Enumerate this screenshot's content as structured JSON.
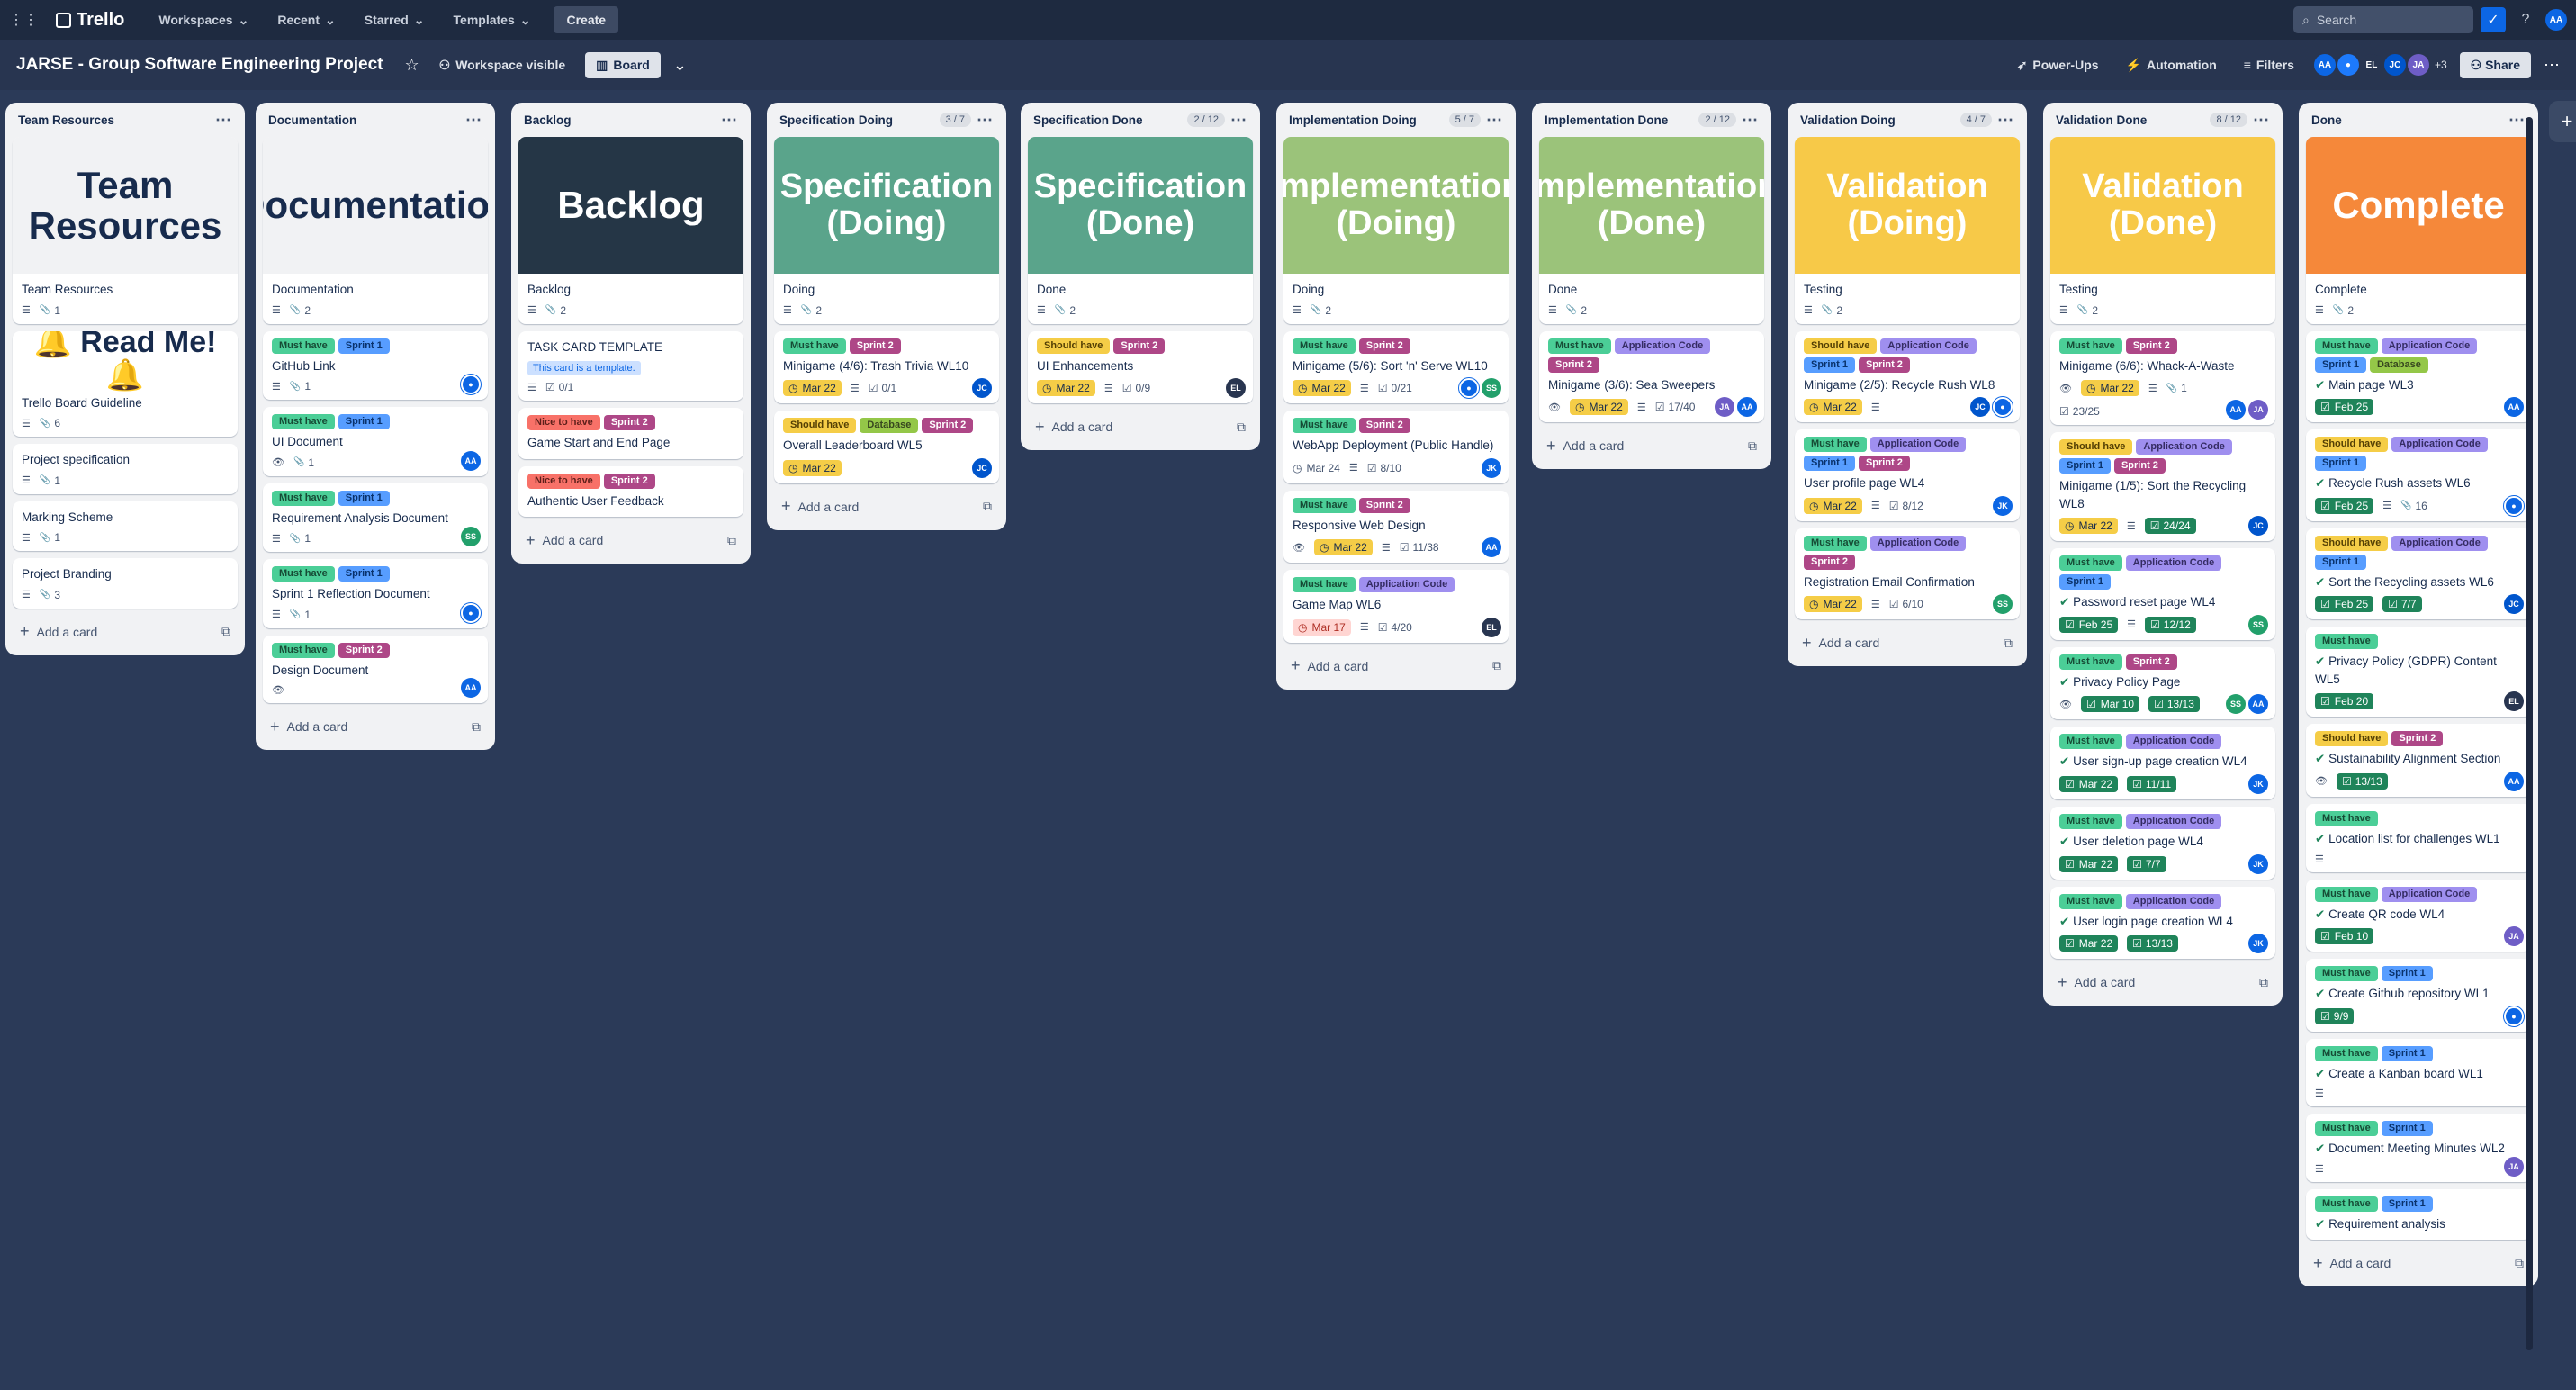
{
  "topnav": {
    "app_name": "Trello",
    "items": [
      "Workspaces",
      "Recent",
      "Starred",
      "Templates"
    ],
    "create_label": "Create",
    "search_placeholder": "Search",
    "user_initials": "AA"
  },
  "board": {
    "title": "JARSE - Group Software Engineering Project",
    "visibility": "Workspace visible",
    "view": "Board",
    "power_ups": "Power-Ups",
    "automation": "Automation",
    "filters": "Filters",
    "members": [
      "AA",
      "EL",
      "JC",
      "JA"
    ],
    "more_members": "+3",
    "share": "Share"
  },
  "colors": {
    "accent": "#0c66e4",
    "board_bg": "#2b3a58"
  },
  "add_card_label": "Add a card",
  "lists": [
    {
      "title": "Team Resources",
      "count": "",
      "cards": [
        {
          "cover": "Team Resources",
          "cover_bg": "#f1f2f4",
          "cover_fg": "#172b4d",
          "title": "Team Resources",
          "desc": true,
          "attach": "1"
        },
        {
          "cover": "🔔 Read Me! 🔔",
          "cover_bg": "#ffffff",
          "cover_fg": "#172b4d",
          "cover_small": true,
          "title": "Trello Board Guideline",
          "desc": true,
          "attach": "6"
        },
        {
          "title": "Project specification",
          "desc": true,
          "attach": "1"
        },
        {
          "title": "Marking Scheme",
          "desc": true,
          "attach": "1"
        },
        {
          "title": "Project Branding",
          "desc": true,
          "attach": "3"
        }
      ]
    },
    {
      "title": "Documentation",
      "count": "",
      "cards": [
        {
          "cover": "Documentation",
          "cover_bg": "#f1f2f4",
          "cover_fg": "#172b4d",
          "title": "Documentation",
          "desc": true,
          "attach": "2"
        },
        {
          "labels": [
            "Must have",
            "Sprint 1"
          ],
          "title": "GitHub Link",
          "desc": true,
          "attach": "1",
          "members": [
            "blue"
          ]
        },
        {
          "labels": [
            "Must have",
            "Sprint 1"
          ],
          "title": "UI Document",
          "watch": true,
          "attach": "1",
          "members": [
            "AA"
          ]
        },
        {
          "labels": [
            "Must have",
            "Sprint 1"
          ],
          "title": "Requirement Analysis Document",
          "desc": true,
          "attach": "1",
          "members": [
            "SS"
          ]
        },
        {
          "labels": [
            "Must have",
            "Sprint 1"
          ],
          "title": "Sprint 1 Reflection Document",
          "desc": true,
          "attach": "1",
          "members": [
            "blue"
          ]
        },
        {
          "labels": [
            "Must have",
            "Sprint 2"
          ],
          "title": "Design Document",
          "watch": true,
          "members": [
            "AA"
          ]
        }
      ]
    },
    {
      "title": "Backlog",
      "count": "",
      "cards": [
        {
          "cover": "Backlog",
          "cover_bg": "#253646",
          "cover_fg": "#ffffff",
          "title": "Backlog",
          "desc": true,
          "attach": "2"
        },
        {
          "title": "TASK CARD TEMPLATE",
          "template": "This card is a template.",
          "desc": true,
          "check": "0/1"
        },
        {
          "labels": [
            "Nice to have",
            "Sprint 2"
          ],
          "title": "Game Start and End Page"
        },
        {
          "labels": [
            "Nice to have",
            "Sprint 2"
          ],
          "title": "Authentic User Feedback"
        }
      ]
    },
    {
      "title": "Specification Doing",
      "count": "3 / 7",
      "cards": [
        {
          "cover": "Specification (Doing)",
          "cover_bg": "#5aa48b",
          "cover_fg": "#ffffff",
          "title": "Doing",
          "desc": true,
          "attach": "2"
        },
        {
          "labels": [
            "Must have",
            "Sprint 2"
          ],
          "title": "Minigame (4/6): Trash Trivia WL10",
          "due": "Mar 22",
          "due_state": "warn",
          "desc": true,
          "check": "0/1",
          "members": [
            "JC"
          ]
        },
        {
          "labels": [
            "Should have",
            "Database",
            "Sprint 2"
          ],
          "title": "Overall Leaderboard WL5",
          "due": "Mar 22",
          "due_state": "warn",
          "members": [
            "JC"
          ]
        }
      ]
    },
    {
      "title": "Specification Done",
      "count": "2 / 12",
      "cards": [
        {
          "cover": "Specification (Done)",
          "cover_bg": "#5aa48b",
          "cover_fg": "#ffffff",
          "title": "Done",
          "desc": true,
          "attach": "2"
        },
        {
          "labels": [
            "Should have",
            "Sprint 2"
          ],
          "title": "UI Enhancements",
          "due": "Mar 22",
          "due_state": "warn",
          "desc": true,
          "check": "0/9",
          "members": [
            "EL"
          ]
        }
      ]
    },
    {
      "title": "Implementation Doing",
      "count": "5 / 7",
      "cards": [
        {
          "cover": "Implementation (Doing)",
          "cover_bg": "#9bc37a",
          "cover_fg": "#ffffff",
          "title": "Doing",
          "desc": true,
          "attach": "2"
        },
        {
          "labels": [
            "Must have",
            "Sprint 2"
          ],
          "title": "Minigame (5/6): Sort 'n' Serve WL10",
          "due": "Mar 22",
          "due_state": "warn",
          "desc": true,
          "check": "0/21",
          "members": [
            "blue",
            "SS"
          ]
        },
        {
          "labels": [
            "Must have",
            "Sprint 2"
          ],
          "title": "WebApp Deployment (Public Handle)",
          "due": "Mar 24",
          "due_state": "plain",
          "desc": true,
          "check": "8/10",
          "members": [
            "JK"
          ]
        },
        {
          "labels": [
            "Must have",
            "Sprint 2"
          ],
          "title": "Responsive Web Design",
          "watch": true,
          "due": "Mar 22",
          "due_state": "warn",
          "desc": true,
          "check": "11/38",
          "members": [
            "AA"
          ]
        },
        {
          "labels": [
            "Must have",
            "Application Code"
          ],
          "title": "Game Map WL6",
          "due": "Mar 17",
          "due_state": "over",
          "desc": true,
          "check": "4/20",
          "members": [
            "EL"
          ]
        }
      ]
    },
    {
      "title": "Implementation Done",
      "count": "2 / 12",
      "cards": [
        {
          "cover": "Implementation (Done)",
          "cover_bg": "#9bc37a",
          "cover_fg": "#ffffff",
          "title": "Done",
          "desc": true,
          "attach": "2"
        },
        {
          "labels": [
            "Must have",
            "Application Code",
            "Sprint 2"
          ],
          "title": "Minigame (3/6): Sea Sweepers",
          "watch": true,
          "due": "Mar 22",
          "due_state": "warn",
          "desc": true,
          "check": "17/40",
          "members": [
            "JA",
            "AA"
          ]
        }
      ]
    },
    {
      "title": "Validation Doing",
      "count": "4 / 7",
      "cards": [
        {
          "cover": "Validation (Doing)",
          "cover_bg": "#f7c948",
          "cover_fg": "#ffffff",
          "title": "Testing",
          "desc": true,
          "attach": "2"
        },
        {
          "labels": [
            "Should have",
            "Application Code",
            "Sprint 1",
            "Sprint 2"
          ],
          "title": "Minigame (2/5): Recycle Rush WL8",
          "due": "Mar 22",
          "due_state": "warn",
          "desc": true,
          "members": [
            "JC",
            "blue"
          ]
        },
        {
          "labels": [
            "Must have",
            "Application Code",
            "Sprint 1",
            "Sprint 2"
          ],
          "title": "User profile page WL4",
          "due": "Mar 22",
          "due_state": "warn",
          "desc": true,
          "check": "8/12",
          "members": [
            "JK"
          ]
        },
        {
          "labels": [
            "Must have",
            "Application Code",
            "Sprint 2"
          ],
          "title": "Registration Email Confirmation",
          "due": "Mar 22",
          "due_state": "warn",
          "desc": true,
          "check": "6/10",
          "members": [
            "SS"
          ]
        }
      ]
    },
    {
      "title": "Validation Done",
      "count": "8 / 12",
      "cards": [
        {
          "cover": "Validation (Done)",
          "cover_bg": "#f7c948",
          "cover_fg": "#ffffff",
          "title": "Testing",
          "desc": true,
          "attach": "2"
        },
        {
          "labels": [
            "Must have",
            "Sprint 2"
          ],
          "title": "Minigame (6/6): Whack-A-Waste",
          "watch": true,
          "due": "Mar 22",
          "due_state": "warn",
          "desc": true,
          "attach": "1",
          "check": "23/25",
          "members": [
            "AA",
            "JA"
          ]
        },
        {
          "labels": [
            "Should have",
            "Application Code",
            "Sprint 1",
            "Sprint 2"
          ],
          "title": "Minigame (1/5): Sort the Recycling WL8",
          "due": "Mar 22",
          "due_state": "warn",
          "desc": true,
          "check": "24/24",
          "check_done": true,
          "members": [
            "JC"
          ]
        },
        {
          "labels": [
            "Must have",
            "Application Code",
            "Sprint 1"
          ],
          "title": "Password reset page WL4",
          "done": true,
          "due": "Feb 25",
          "due_state": "done",
          "desc": true,
          "check": "12/12",
          "check_done": true,
          "members": [
            "SS"
          ]
        },
        {
          "labels": [
            "Must have",
            "Sprint 2"
          ],
          "title": "Privacy Policy Page",
          "done": true,
          "watch": true,
          "due": "Mar 10",
          "due_state": "done",
          "check": "13/13",
          "check_done": true,
          "members": [
            "SS",
            "AA"
          ]
        },
        {
          "labels": [
            "Must have",
            "Application Code"
          ],
          "title": "User sign-up page creation WL4",
          "done": true,
          "due": "Mar 22",
          "due_state": "done",
          "check": "11/11",
          "check_done": true,
          "members": [
            "JK"
          ]
        },
        {
          "labels": [
            "Must have",
            "Application Code"
          ],
          "title": "User deletion page WL4",
          "done": true,
          "due": "Mar 22",
          "due_state": "done",
          "check": "7/7",
          "check_done": true,
          "members": [
            "JK"
          ]
        },
        {
          "labels": [
            "Must have",
            "Application Code"
          ],
          "title": "User login page creation WL4",
          "done": true,
          "due": "Mar 22",
          "due_state": "done",
          "check": "13/13",
          "check_done": true,
          "members": [
            "JK"
          ]
        }
      ]
    },
    {
      "title": "Done",
      "count": "",
      "cards": [
        {
          "cover": "Complete",
          "cover_bg": "#f5883a",
          "cover_fg": "#ffffff",
          "title": "Complete",
          "desc": true,
          "attach": "2"
        },
        {
          "labels": [
            "Must have",
            "Application Code",
            "Sprint 1",
            "Database"
          ],
          "title": "Main page WL3",
          "done": true,
          "due": "Feb 25",
          "due_state": "done",
          "members": [
            "AA"
          ]
        },
        {
          "labels": [
            "Should have",
            "Application Code",
            "Sprint 1"
          ],
          "title": "Recycle Rush assets WL6",
          "done": true,
          "due": "Feb 25",
          "due_state": "done",
          "desc": true,
          "attach": "16",
          "members": [
            "blue"
          ]
        },
        {
          "labels": [
            "Should have",
            "Application Code",
            "Sprint 1"
          ],
          "title": "Sort the Recycling assets WL6",
          "done": true,
          "due": "Feb 25",
          "due_state": "done",
          "check": "7/7",
          "check_done": true,
          "members": [
            "JC"
          ]
        },
        {
          "labels": [
            "Must have"
          ],
          "title": "Privacy Policy (GDPR) Content WL5",
          "done": true,
          "due": "Feb 20",
          "due_state": "done",
          "members": [
            "EL"
          ]
        },
        {
          "labels": [
            "Should have",
            "Sprint 2"
          ],
          "title": "Sustainability Alignment Section",
          "done": true,
          "watch": true,
          "check": "13/13",
          "check_done": true,
          "members": [
            "AA"
          ]
        },
        {
          "labels": [
            "Must have"
          ],
          "title": "Location list for challenges WL1",
          "done": true,
          "desc": true
        },
        {
          "labels": [
            "Must have",
            "Application Code"
          ],
          "title": "Create QR code WL4",
          "done": true,
          "due": "Feb 10",
          "due_state": "done",
          "members": [
            "JA"
          ]
        },
        {
          "labels": [
            "Must have",
            "Sprint 1"
          ],
          "title": "Create Github repository WL1",
          "done": true,
          "check": "9/9",
          "check_done": true,
          "members": [
            "blue"
          ]
        },
        {
          "labels": [
            "Must have",
            "Sprint 1"
          ],
          "title": "Create a Kanban board WL1",
          "done": true,
          "desc": true
        },
        {
          "labels": [
            "Must have",
            "Sprint 1"
          ],
          "title": "Document Meeting Minutes WL2",
          "done": true,
          "desc": true,
          "members": [
            "JA"
          ]
        },
        {
          "labels": [
            "Must have",
            "Sprint 1"
          ],
          "title": "Requirement analysis",
          "done": true
        }
      ]
    }
  ]
}
